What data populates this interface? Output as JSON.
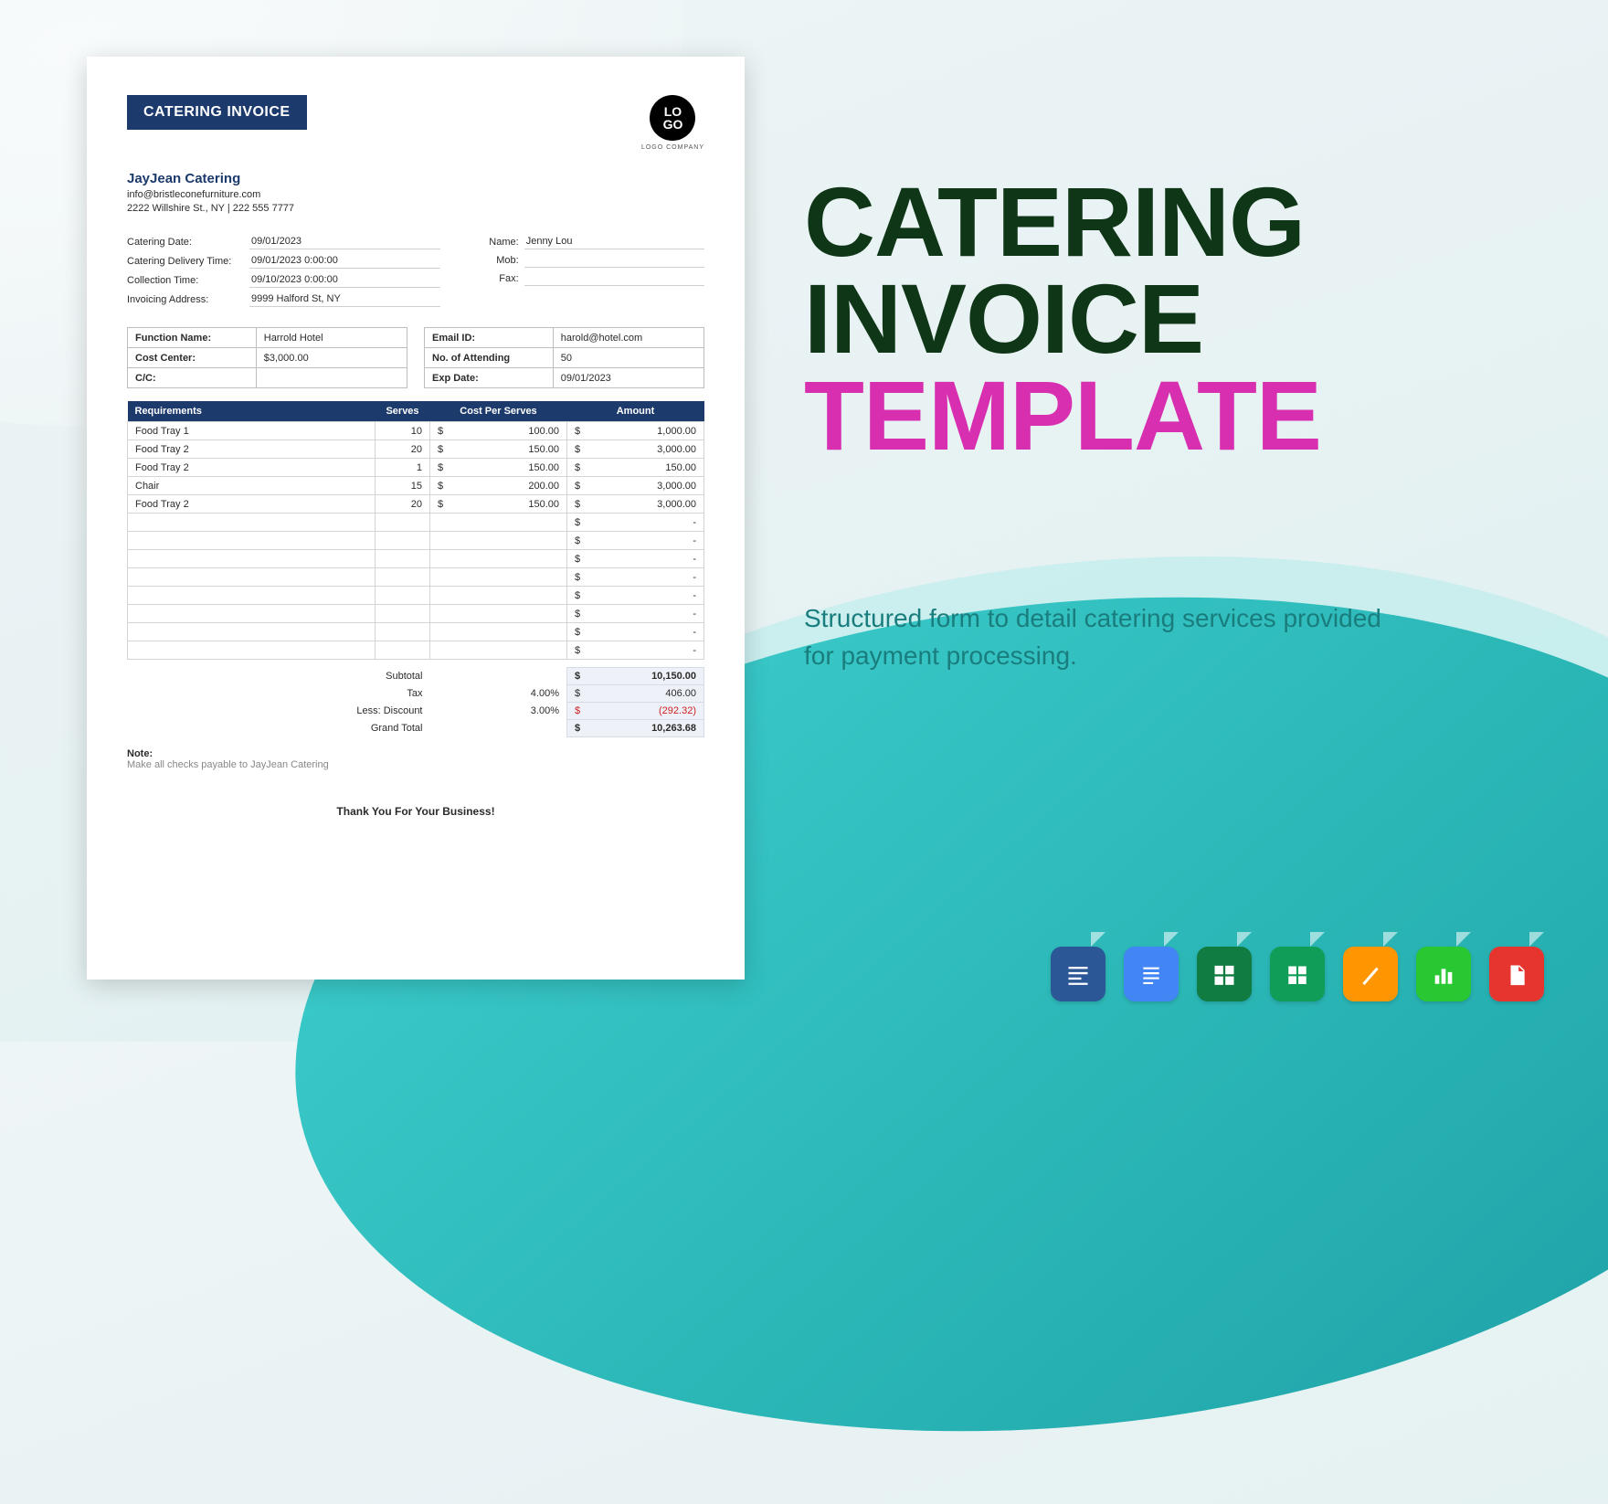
{
  "title": {
    "line1": "CATERING",
    "line2": "INVOICE",
    "accent": "TEMPLATE"
  },
  "description": "Structured form to detail catering services provided for payment processing.",
  "formats": [
    {
      "name": "word",
      "label": "Word"
    },
    {
      "name": "docs",
      "label": "Google Docs"
    },
    {
      "name": "excel",
      "label": "Excel"
    },
    {
      "name": "sheets",
      "label": "Google Sheets"
    },
    {
      "name": "pages",
      "label": "Pages"
    },
    {
      "name": "numbers",
      "label": "Numbers"
    },
    {
      "name": "pdf",
      "label": "PDF"
    }
  ],
  "doc": {
    "badge": "CATERING INVOICE",
    "logo": {
      "text_top": "LO",
      "text_bot": "GO",
      "sub": "LOGO COMPANY"
    },
    "company": {
      "name": "JayJean Catering",
      "email": "info@bristleconefurniture.com",
      "address": "2222 Willshire St., NY | 222 555 7777"
    },
    "info_left": [
      {
        "label": "Catering Date:",
        "value": "09/01/2023"
      },
      {
        "label": "Catering Delivery Time:",
        "value": "09/01/2023 0:00:00"
      },
      {
        "label": "Collection Time:",
        "value": "09/10/2023 0:00:00"
      },
      {
        "label": "Invoicing Address:",
        "value": "9999 Halford St, NY"
      }
    ],
    "info_right": [
      {
        "label": "Name:",
        "value": "Jenny Lou"
      },
      {
        "label": "Mob:",
        "value": ""
      },
      {
        "label": "Fax:",
        "value": ""
      }
    ],
    "box_left": [
      {
        "label": "Function Name:",
        "value": "Harrold Hotel"
      },
      {
        "label": "Cost Center:",
        "value": "$3,000.00"
      },
      {
        "label": "C/C:",
        "value": ""
      }
    ],
    "box_right": [
      {
        "label": "Email ID:",
        "value": "harold@hotel.com"
      },
      {
        "label": "No. of Attending",
        "value": "50"
      },
      {
        "label": "Exp Date:",
        "value": "09/01/2023"
      }
    ],
    "items_header": {
      "req": "Requirements",
      "serves": "Serves",
      "cps": "Cost Per Serves",
      "amt": "Amount"
    },
    "items": [
      {
        "req": "Food Tray 1",
        "serves": "10",
        "cps": "100.00",
        "amt": "1,000.00"
      },
      {
        "req": "Food Tray 2",
        "serves": "20",
        "cps": "150.00",
        "amt": "3,000.00"
      },
      {
        "req": "Food Tray 2",
        "serves": "1",
        "cps": "150.00",
        "amt": "150.00"
      },
      {
        "req": "Chair",
        "serves": "15",
        "cps": "200.00",
        "amt": "3,000.00"
      },
      {
        "req": "Food Tray 2",
        "serves": "20",
        "cps": "150.00",
        "amt": "3,000.00"
      },
      {
        "req": "",
        "serves": "",
        "cps": "",
        "amt": "-"
      },
      {
        "req": "",
        "serves": "",
        "cps": "",
        "amt": "-"
      },
      {
        "req": "",
        "serves": "",
        "cps": "",
        "amt": "-"
      },
      {
        "req": "",
        "serves": "",
        "cps": "",
        "amt": "-"
      },
      {
        "req": "",
        "serves": "",
        "cps": "",
        "amt": "-"
      },
      {
        "req": "",
        "serves": "",
        "cps": "",
        "amt": "-"
      },
      {
        "req": "",
        "serves": "",
        "cps": "",
        "amt": "-"
      },
      {
        "req": "",
        "serves": "",
        "cps": "",
        "amt": "-"
      }
    ],
    "totals": {
      "subtotal_label": "Subtotal",
      "subtotal": "10,150.00",
      "tax_label": "Tax",
      "tax_pct": "4.00%",
      "tax_amt": "406.00",
      "disc_label": "Less: Discount",
      "disc_pct": "3.00%",
      "disc_amt": "(292.32)",
      "grand_label": "Grand Total",
      "grand": "10,263.68",
      "currency": "$"
    },
    "note_label": "Note:",
    "note_text": "Make all checks payable to JayJean Catering",
    "thanks": "Thank You For Your Business!"
  }
}
